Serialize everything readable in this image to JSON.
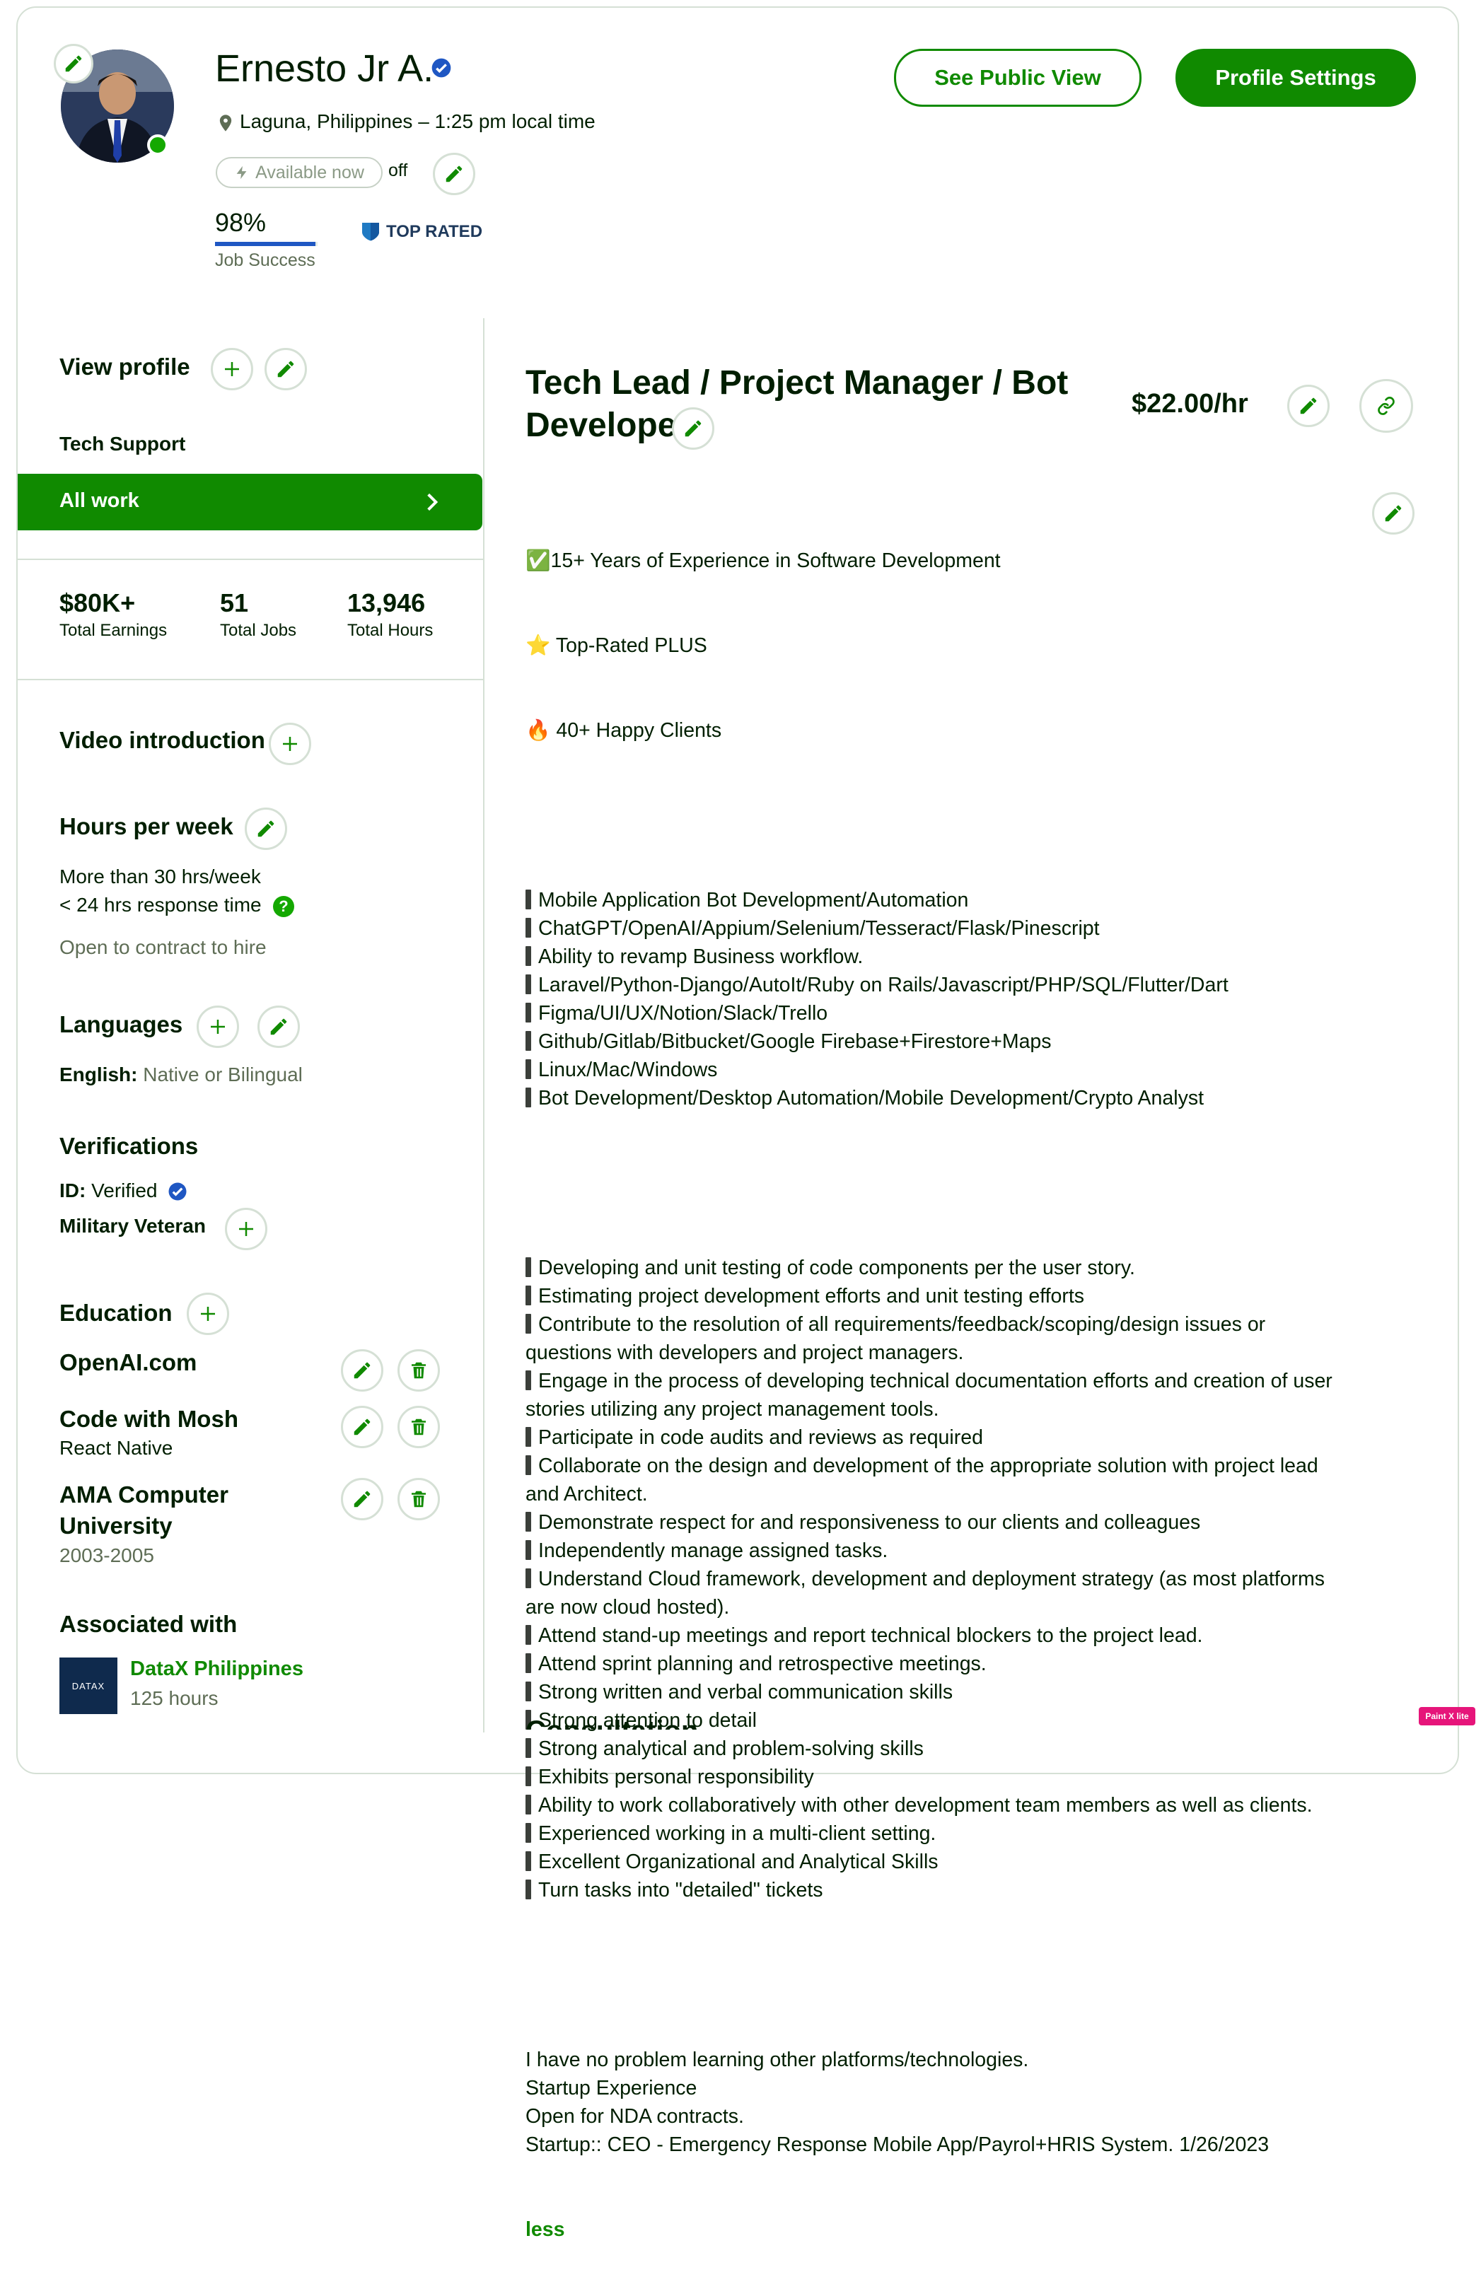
{
  "profile": {
    "name": "Ernesto Jr A.",
    "location": "Laguna, Philippines – 1:25 pm local time",
    "available_label": "Available now",
    "available_state": "off",
    "job_success_pct": "98%",
    "job_success_label": "Job Success",
    "job_success_fraction": 0.98,
    "badge_label": "TOP RATED"
  },
  "header_buttons": {
    "public_view": "See Public View",
    "settings": "Profile Settings"
  },
  "sidebar": {
    "view_profile": "View profile",
    "specialized": "Tech Support",
    "all_work": "All work",
    "stats": [
      {
        "value": "$80K+",
        "label": "Total Earnings"
      },
      {
        "value": "51",
        "label": "Total Jobs"
      },
      {
        "value": "13,946",
        "label": "Total Hours"
      }
    ],
    "video_intro": "Video introduction",
    "hours_title": "Hours per week",
    "hours_value": "More than 30 hrs/week",
    "response_time": "< 24 hrs response time",
    "contract": "Open to contract to hire",
    "languages_title": "Languages",
    "language_name": "English:",
    "language_level": "Native or Bilingual",
    "verifications_title": "Verifications",
    "id_label": "ID:",
    "id_value": "Verified",
    "military": "Military Veteran",
    "education_title": "Education",
    "education": [
      {
        "school": "OpenAI.com",
        "detail": ""
      },
      {
        "school": "Code with Mosh",
        "detail": "React Native"
      },
      {
        "school": "AMA Computer University",
        "detail": "2003-2005"
      }
    ],
    "associated_title": "Associated with",
    "agency_logo_text": "DATAX",
    "agency_name": "DataX Philippines",
    "agency_hours": "125 hours"
  },
  "main": {
    "title": "Tech Lead / Project Manager / Bot Developer",
    "rate": "$22.00/hr",
    "highlights": [
      {
        "icon": "✅",
        "text": "15+ Years of Experience in Software Development"
      },
      {
        "icon": "⭐",
        "text": " Top-Rated PLUS"
      },
      {
        "icon": "🔥",
        "text": " 40+ Happy Clients"
      }
    ],
    "skills": [
      "Mobile Application Bot Development/Automation",
      "ChatGPT/OpenAI/Appium/Selenium/Tesseract/Flask/Pinescript",
      "Ability to revamp Business workflow.",
      "Laravel/Python-Django/AutoIt/Ruby on Rails/Javascript/PHP/SQL/Flutter/Dart",
      "Figma/UI/UX/Notion/Slack/Trello",
      "Github/Gitlab/Bitbucket/Google Firebase+Firestore+Maps",
      "Linux/Mac/Windows",
      "Bot Development/Desktop Automation/Mobile Development/Crypto Analyst"
    ],
    "duties": [
      "Developing and unit testing of code components per the user story.",
      "Estimating project development efforts and unit testing efforts",
      "Contribute to the resolution of all requirements/feedback/scoping/design issues or questions with developers and project managers.",
      "Engage in the process of developing technical documentation efforts and creation of user stories utilizing any project management tools.",
      "Participate in code audits and reviews as required",
      "Collaborate on the design and development of the appropriate solution with project lead and Architect.",
      "Demonstrate respect for and responsiveness to our clients and colleagues",
      "Independently manage assigned tasks.",
      "Understand Cloud framework, development and deployment strategy (as most platforms are now cloud hosted).",
      "Attend stand-up meetings and report technical blockers to the project lead.",
      "Attend sprint planning and retrospective meetings.",
      "Strong written and verbal communication skills",
      "Strong attention to detail",
      "Strong analytical and problem-solving skills",
      "Exhibits personal responsibility",
      "Ability to work collaboratively with other development team members as well as clients.",
      "Experienced working in a multi-client setting.",
      "Excellent Organizational and Analytical Skills",
      "Turn tasks into \"detailed\" tickets"
    ],
    "closing": [
      "I have no problem learning other platforms/technologies.",
      "Startup Experience",
      "Open for NDA contracts.",
      "Startup:: CEO - Emergency Response Mobile App/Payrol+HRIS System. 1/26/2023"
    ],
    "less_link": "less",
    "cut_heading": "Consultation"
  },
  "watermark": "Paint X lite",
  "colors": {
    "brand": "#108a00",
    "border": "#d5e0d5",
    "verified": "#1f57c3"
  }
}
